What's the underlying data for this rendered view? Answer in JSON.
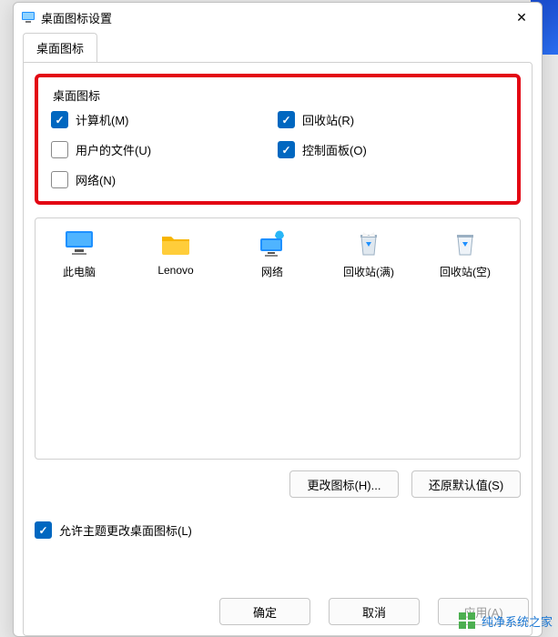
{
  "window": {
    "title": "桌面图标设置"
  },
  "tab": {
    "label": "桌面图标"
  },
  "group": {
    "legend": "桌面图标",
    "checks": [
      {
        "label": "计算机(M)",
        "checked": true
      },
      {
        "label": "回收站(R)",
        "checked": true
      },
      {
        "label": "用户的文件(U)",
        "checked": false
      },
      {
        "label": "控制面板(O)",
        "checked": true
      },
      {
        "label": "网络(N)",
        "checked": false
      }
    ]
  },
  "icons": [
    {
      "label": "此电脑",
      "glyph": "pc"
    },
    {
      "label": "Lenovo",
      "glyph": "folder"
    },
    {
      "label": "网络",
      "glyph": "net"
    },
    {
      "label": "回收站(满)",
      "glyph": "bin-full"
    },
    {
      "label": "回收站(空)",
      "glyph": "bin-empty"
    }
  ],
  "buttons": {
    "change_icon": "更改图标(H)...",
    "restore_defaults": "还原默认值(S)"
  },
  "allow_theme": {
    "label": "允许主题更改桌面图标(L)",
    "checked": true
  },
  "dialog_buttons": {
    "ok": "确定",
    "cancel": "取消",
    "apply": "应用(A)"
  },
  "watermark": {
    "text": "纯净系统之家"
  }
}
